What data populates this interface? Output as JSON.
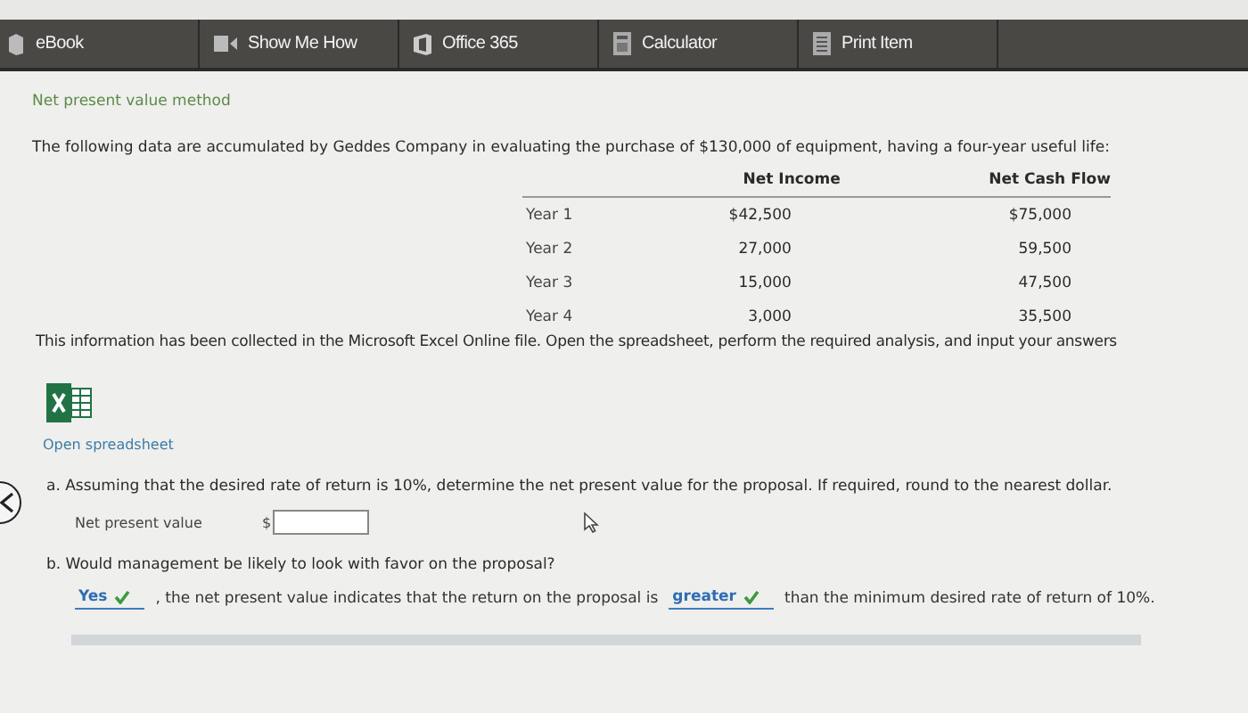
{
  "toolbar": [
    {
      "label": "eBook",
      "kind": "book"
    },
    {
      "label": "Show Me How",
      "kind": "video"
    },
    {
      "label": "Office 365",
      "kind": "office"
    },
    {
      "label": "Calculator",
      "kind": "calculator"
    },
    {
      "label": "Print Item",
      "kind": "print"
    }
  ],
  "title": "Net present value method",
  "intro": "The following data are accumulated by Geddes Company in evaluating the purchase of $130,000 of equipment, having a four-year useful life:",
  "table": {
    "columns": [
      "Net Income",
      "Net Cash Flow"
    ],
    "rows": [
      {
        "label": "Year 1",
        "cells": [
          "$42,500",
          "$75,000"
        ]
      },
      {
        "label": "Year 2",
        "cells": [
          "27,000",
          "59,500"
        ]
      },
      {
        "label": "Year 3",
        "cells": [
          "15,000",
          "47,500"
        ]
      },
      {
        "label": "Year 4",
        "cells": [
          "3,000",
          "35,500"
        ]
      }
    ]
  },
  "info": "This information has been collected in the Microsoft Excel Online file. Open the spreadsheet, perform the required analysis, and input your answers",
  "spreadsheet_link": "Open spreadsheet",
  "question_a": "a. Assuming that the desired rate of return is 10%, determine the net present value for the proposal. If required, round to the nearest dollar.",
  "npv_field": {
    "label": "Net present value",
    "currency": "$"
  },
  "question_b": "b. Would management be likely to look with favor on the proposal?",
  "answer_b": [
    {
      "kind": "select",
      "value": "Yes",
      "correct": true
    },
    {
      "kind": "text",
      "text": ", the net present value indicates that the return on the proposal is"
    },
    {
      "kind": "select",
      "value": "greater",
      "correct": true
    },
    {
      "kind": "text",
      "text": "than the minimum desired rate of return of 10%."
    }
  ]
}
